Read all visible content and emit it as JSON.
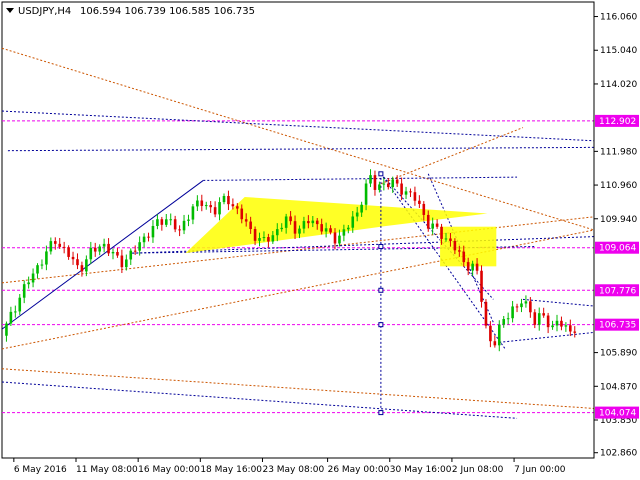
{
  "chart_data": {
    "type": "candlestick",
    "symbol_label": "USDJPY,H4",
    "ohlc_label": "106.594 106.739 106.585 106.735",
    "ylim": [
      102.7,
      116.5
    ],
    "yticks": [
      "116.060",
      "115.040",
      "114.020",
      "112.902",
      "111.980",
      "110.960",
      "109.940",
      "109.064",
      "107.776",
      "106.735",
      "105.890",
      "104.870",
      "104.074",
      "103.850",
      "102.860"
    ],
    "xlim": [
      0,
      100
    ],
    "xticks": [
      {
        "x": 2,
        "label": "6 May 2016"
      },
      {
        "x": 12.5,
        "label": "11 May 08:00"
      },
      {
        "x": 23,
        "label": "16 May 00:00"
      },
      {
        "x": 33.5,
        "label": "18 May 16:00"
      },
      {
        "x": 44,
        "label": "23 May 08:00"
      },
      {
        "x": 55,
        "label": "26 May 00:00"
      },
      {
        "x": 65.5,
        "label": "30 May 16:00"
      },
      {
        "x": 76,
        "label": "2 Jun 08:00"
      },
      {
        "x": 86.5,
        "label": "7 Jun 00:00"
      }
    ],
    "highlight_levels": [
      {
        "value": 112.902,
        "label": "112.902",
        "color": "#ee00ee"
      },
      {
        "value": 109.064,
        "label": "109.064",
        "color": "#ee00ee"
      },
      {
        "value": 107.776,
        "label": "107.776",
        "color": "#ee00ee"
      },
      {
        "value": 106.735,
        "label": "106.735",
        "color": "#ee00ee"
      },
      {
        "value": 104.074,
        "label": "104.074",
        "color": "#ee00ee"
      }
    ],
    "series": [
      {
        "close_path": [
          [
            0,
            106.4
          ],
          [
            3,
            107.6
          ],
          [
            6,
            108.5
          ],
          [
            9,
            109.3
          ],
          [
            11,
            108.9
          ],
          [
            13,
            108.4
          ],
          [
            15,
            108.9
          ],
          [
            17,
            109.2
          ],
          [
            20,
            108.6
          ],
          [
            22,
            108.9
          ],
          [
            25,
            109.6
          ],
          [
            28,
            110.0
          ],
          [
            30,
            109.5
          ],
          [
            32,
            110.3
          ],
          [
            34,
            110.4
          ],
          [
            36,
            110.2
          ],
          [
            38,
            110.6
          ],
          [
            40,
            110.1
          ],
          [
            42,
            109.6
          ],
          [
            44,
            109.2
          ],
          [
            46,
            109.5
          ],
          [
            48,
            109.9
          ],
          [
            50,
            109.6
          ],
          [
            52,
            109.9
          ],
          [
            54,
            109.7
          ],
          [
            56,
            109.3
          ],
          [
            58,
            109.6
          ],
          [
            60,
            110.1
          ],
          [
            61,
            110.7
          ],
          [
            62,
            111.2
          ],
          [
            63,
            110.9
          ],
          [
            64,
            111.0
          ],
          [
            66,
            111.0
          ],
          [
            68,
            110.8
          ],
          [
            70,
            110.5
          ],
          [
            72,
            109.8
          ],
          [
            74,
            109.5
          ],
          [
            76,
            109.2
          ],
          [
            78,
            108.6
          ],
          [
            80,
            108.5
          ],
          [
            81,
            107.5
          ],
          [
            82,
            106.4
          ],
          [
            83,
            106.1
          ],
          [
            84,
            106.6
          ],
          [
            85,
            106.9
          ],
          [
            86,
            107.3
          ],
          [
            87,
            107.2
          ],
          [
            88,
            107.5
          ],
          [
            89,
            107.2
          ],
          [
            90,
            106.9
          ],
          [
            91,
            107.0
          ],
          [
            92,
            106.8
          ],
          [
            93,
            106.7
          ],
          [
            94,
            106.9
          ],
          [
            95,
            106.6
          ],
          [
            96,
            106.5
          ],
          [
            97,
            106.735
          ]
        ]
      }
    ],
    "colors": {
      "bull": "#00bb00",
      "bear": "#dd0000",
      "levels": "#ee00ee",
      "trend": "#000099",
      "fib": "#cc5500",
      "fill": "#ffff00"
    }
  }
}
